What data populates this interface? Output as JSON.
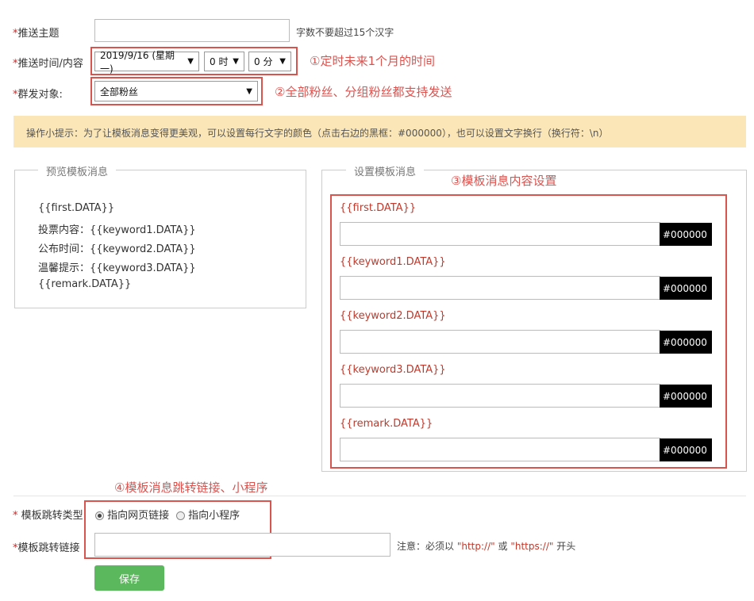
{
  "form": {
    "subject_label": "推送主题",
    "subject_value": "",
    "subject_note": "字数不要超过15个汉字",
    "time_label": "推送时间/内容",
    "date_value": "2019/9/16 (星期一)",
    "hour_value": "0 时",
    "minute_value": "0 分",
    "target_label": "群发对象:",
    "target_value": "全部粉丝"
  },
  "annotations": {
    "a1": "①定时未来1个月的时间",
    "a2": "②全部粉丝、分组粉丝都支持发送",
    "a3": "③模板消息内容设置",
    "a4": "④模板消息跳转链接、小程序"
  },
  "hint": "操作小提示：为了让模板消息变得更美观，可以设置每行文字的颜色（点击右边的黑框：#000000），也可以设置文字换行（换行符：\\n）",
  "preview": {
    "title": "预览模板消息",
    "lines": [
      "{{first.DATA}}",
      "投票内容：{{keyword1.DATA}}",
      "公布时间：{{keyword2.DATA}}",
      "温馨提示：{{keyword3.DATA}}",
      "{{remark.DATA}}"
    ]
  },
  "settings": {
    "title": "设置模板消息",
    "fields": [
      {
        "label": "{{first.DATA}}",
        "value": "",
        "color": "#000000"
      },
      {
        "label": "{{keyword1.DATA}}",
        "value": "",
        "color": "#000000"
      },
      {
        "label": "{{keyword2.DATA}}",
        "value": "",
        "color": "#000000"
      },
      {
        "label": "{{keyword3.DATA}}",
        "value": "",
        "color": "#000000"
      },
      {
        "label": "{{remark.DATA}}",
        "value": "",
        "color": "#000000"
      }
    ]
  },
  "jump": {
    "type_label": "模板跳转类型",
    "option_web": "指向网页链接",
    "option_mini": "指向小程序",
    "selected": "web",
    "link_label": "模板跳转链接",
    "link_value": "",
    "note_prefix": "注意：必须以",
    "note_http": "\"http://\"",
    "note_or": "或",
    "note_https": "\"https://\"",
    "note_suffix": "开头"
  },
  "save_label": "保存",
  "colors": {
    "accent_red": "#d9534f",
    "save_green": "#5cb85c",
    "hint_bg": "#fbe6b8"
  }
}
